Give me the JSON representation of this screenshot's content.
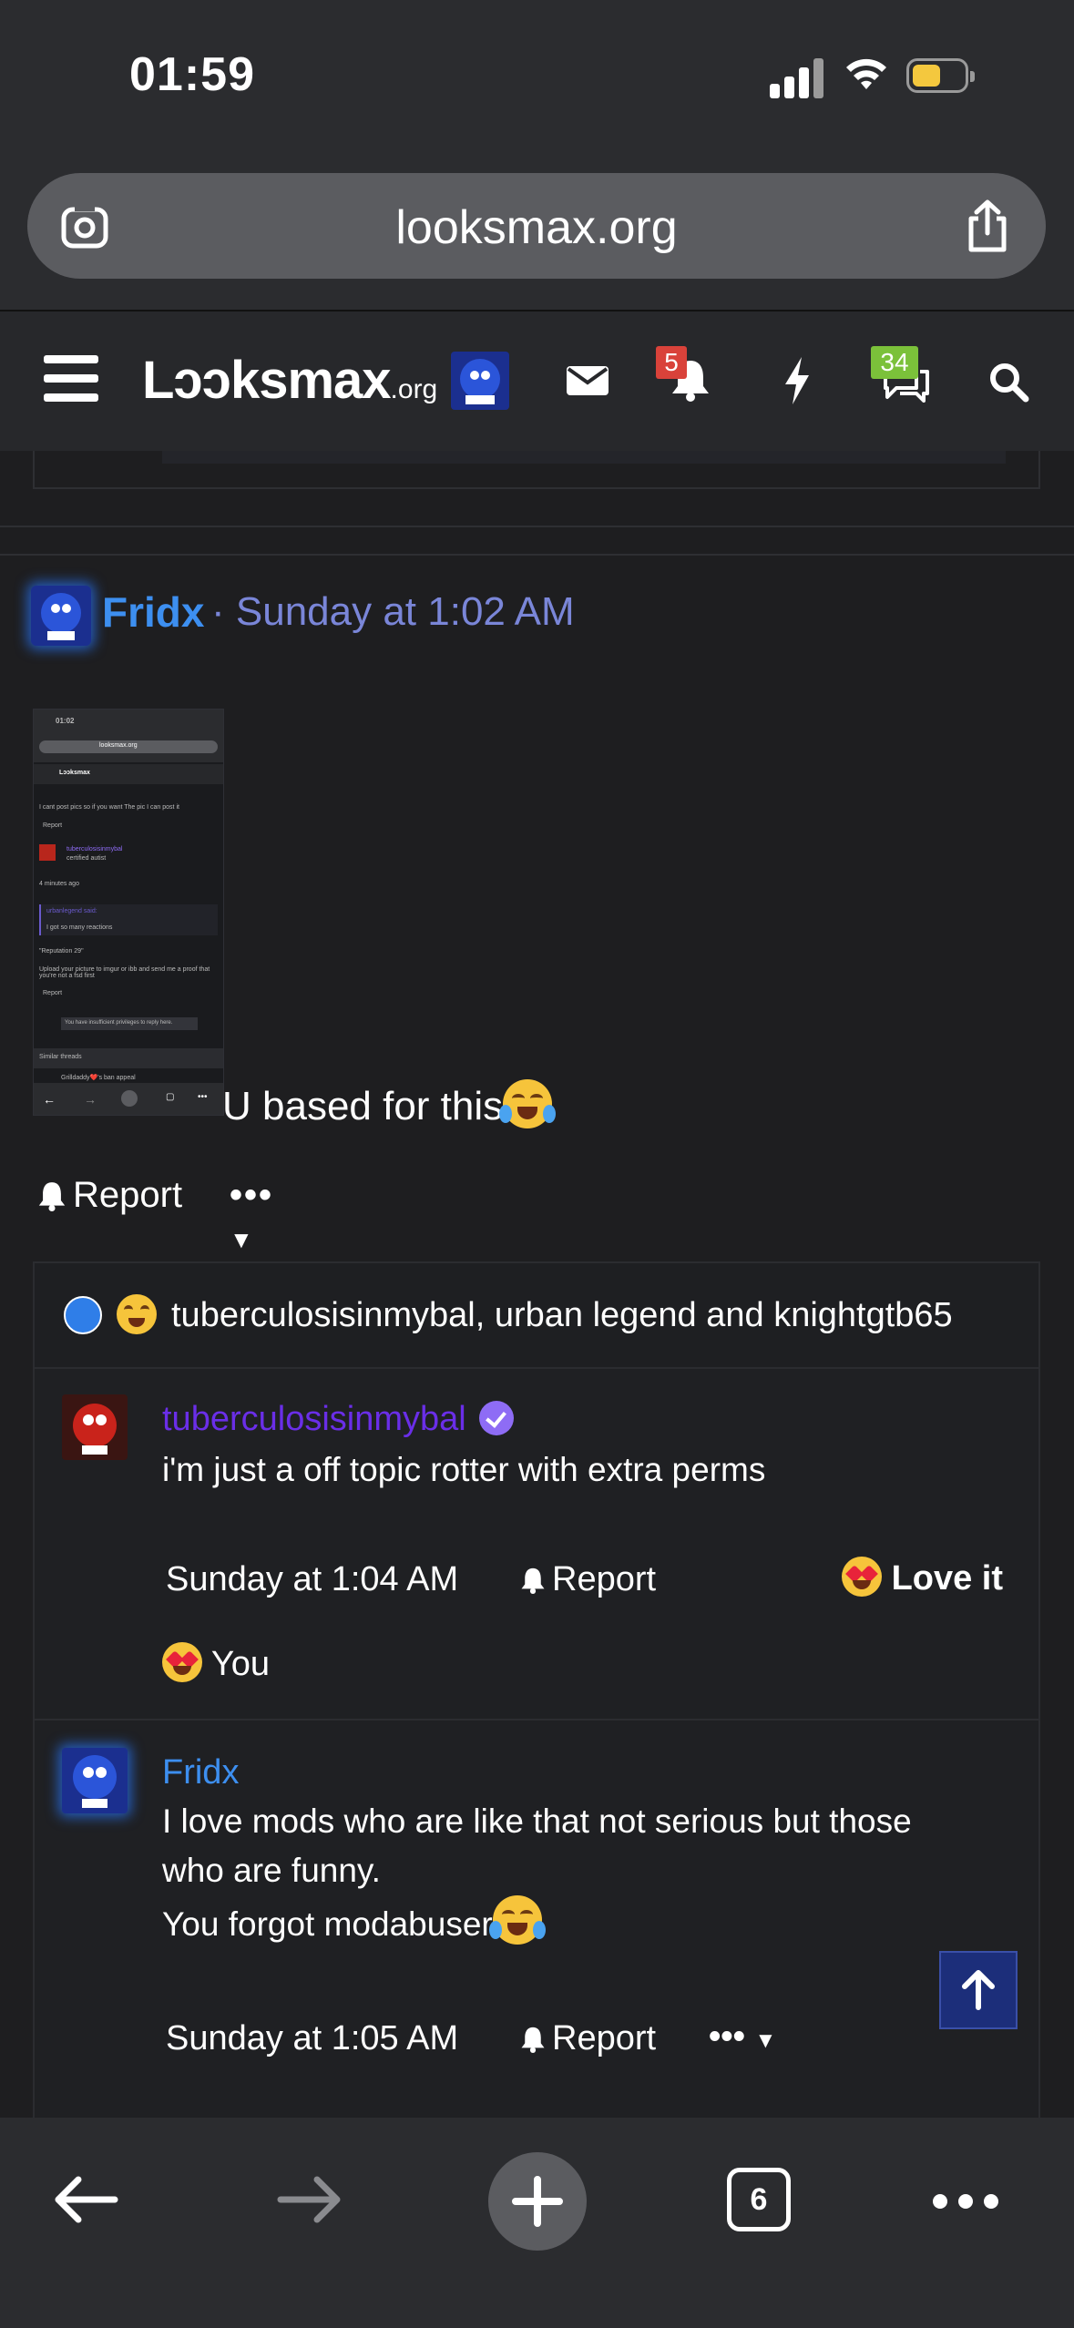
{
  "status_bar": {
    "time": "01:59"
  },
  "browser": {
    "url": "looksmax.org",
    "tab_count": "6"
  },
  "site_header": {
    "logo_text": "Lɔɔksmax",
    "logo_suffix": ".org",
    "alerts_badge": "5",
    "conversations_badge": "34"
  },
  "post": {
    "author": "Fridx",
    "timestamp": "· Sunday at 1:02 AM",
    "text": "U based for this",
    "report_label": "Report",
    "more_label": "•••",
    "thumbnail": {
      "time": "01:02",
      "url": "looksmax.org",
      "line1": "I cant post pics so if you want The pic I can post it",
      "report": "Report",
      "user": "tuberculosisinmybal",
      "user_sub": "certified autist",
      "quote_author": "urbanlegend said:",
      "quote_text": "I got so many reactions",
      "rep": "\"Reputation 29\"",
      "upload": "Upload your picture to imgur or ibb and send me a proof that you're not a fsd first",
      "notice": "You have insufficient privileges to reply here.",
      "similar": "Similar threads",
      "similar_item": "Grilldaddy❤️'s ban appeal"
    }
  },
  "reactions": {
    "names": "tuberculosisinmybal, urban legend and knightgtb65"
  },
  "comments": [
    {
      "author": "tuberculosisinmybal",
      "text": "i'm just a off topic rotter with extra perms",
      "timestamp": "Sunday at 1:04 AM",
      "report_label": "Report",
      "reaction_label": "Love it",
      "reacted_by": "You"
    },
    {
      "author": "Fridx",
      "text_line1": "I love mods who are like that not serious but those",
      "text_line2": "who are funny.",
      "text_line3": "You forgot modabuser",
      "timestamp": "Sunday at 1:05 AM",
      "report_label": "Report",
      "more_label": "•••"
    }
  ],
  "colors": {
    "accent_blue": "#3d8ff0",
    "time_link": "#7a86d8",
    "mod_purple": "#6a2ee8",
    "badge_red": "#d9423a",
    "badge_green": "#7bc13a"
  }
}
